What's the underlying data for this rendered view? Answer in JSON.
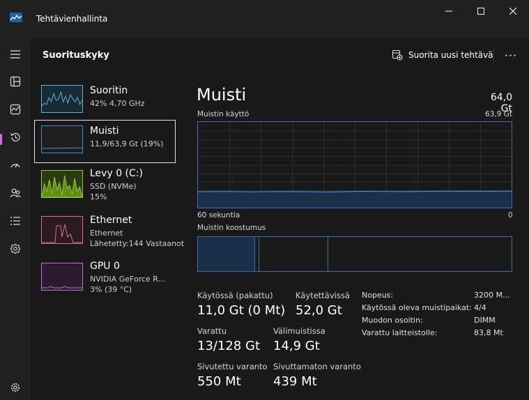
{
  "window": {
    "title": "Tehtävienhallinta",
    "icon": "task-manager-icon"
  },
  "nav": {
    "items": [
      {
        "name": "hamburger-menu-icon"
      },
      {
        "name": "processes-icon"
      },
      {
        "name": "performance-icon"
      },
      {
        "name": "app-history-icon"
      },
      {
        "name": "startup-apps-icon"
      },
      {
        "name": "users-icon"
      },
      {
        "name": "details-icon"
      },
      {
        "name": "services-icon"
      },
      {
        "name": "settings-icon"
      }
    ],
    "active_color": "#d86be0"
  },
  "header": {
    "title": "Suorituskyky",
    "run_task_label": "Suorita uusi tehtävä",
    "more_label": "···"
  },
  "perf_list": [
    {
      "name": "Suoritin",
      "lines": [
        "42% 4,70 GHz"
      ],
      "color": "#4fb5e0"
    },
    {
      "name": "Muisti",
      "lines": [
        "11,9/63,9 Gt (19%)"
      ],
      "color": "#4a8ad6"
    },
    {
      "name": "Levy 0 (C:)",
      "lines": [
        "SSD (NVMe)",
        "15%"
      ],
      "color": "#8ccc2c"
    },
    {
      "name": "Ethernet",
      "lines": [
        "Ethernet",
        "Lähetetty:144 Vastaanot"
      ],
      "color": "#e06c8a"
    },
    {
      "name": "GPU 0",
      "lines": [
        "NVIDIA GeForce R...",
        "3% (39 °C)"
      ],
      "color": "#c76ad8"
    }
  ],
  "detail": {
    "title": "Muisti",
    "total": "64,0 Gt",
    "usage_label": "Muistin käyttö",
    "usage_max": "63,9 Gt",
    "time_label": "60 sekuntia",
    "time_end": "0",
    "composition_label": "Muistin koostumus",
    "usage_fraction": 0.19,
    "composition": {
      "in_use": 0.18,
      "modified": 0.015,
      "standby": 0.22,
      "free": 0.585
    }
  },
  "stats": {
    "in_use_label": "Käytössä (pakattu)",
    "in_use_value": "11,0 Gt (0 Mt)",
    "available_label": "Käytettävissä",
    "available_value": "52,0 Gt",
    "committed_label": "Varattu",
    "committed_value": "13/128 Gt",
    "cached_label": "Välimuistissa",
    "cached_value": "14,9 Gt",
    "paged_label": "Sivutettu varanto",
    "paged_value": "550 Mt",
    "nonpaged_label": "Sivuttamaton varanto",
    "nonpaged_value": "439 Mt"
  },
  "props": [
    {
      "label": "Nopeus:",
      "value": "3200 M..."
    },
    {
      "label": "Käytössä oleva muistipaikat:",
      "value": "4/4"
    },
    {
      "label": "Muodon osoitin:",
      "value": "DIMM"
    },
    {
      "label": "Varattu laitteistolle:",
      "value": "83,8 Mt"
    }
  ]
}
